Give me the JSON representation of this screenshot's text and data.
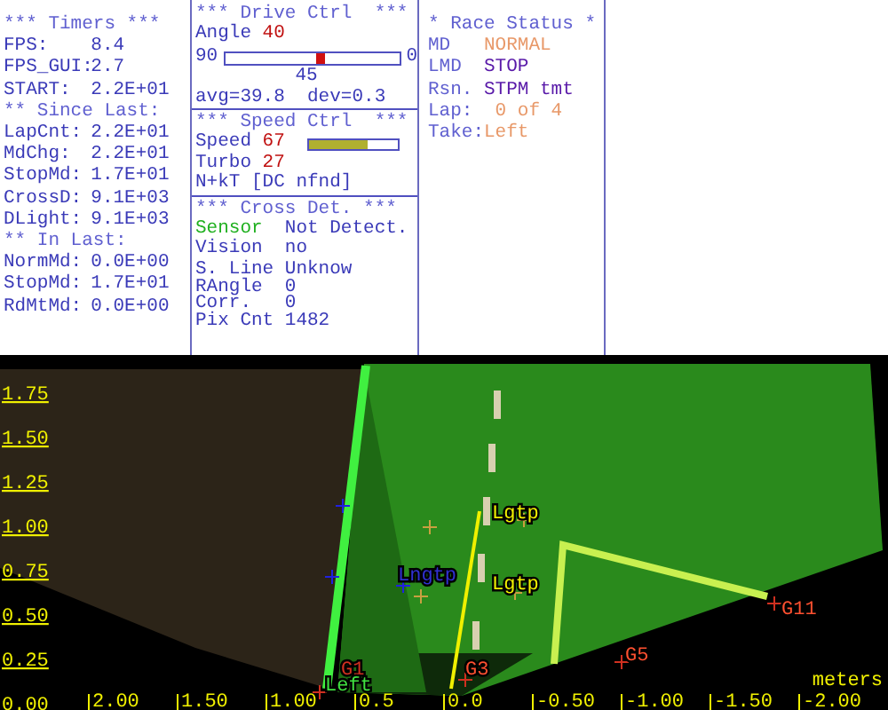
{
  "timers": [
    {
      "kind": "header",
      "text": "*** Timers ***"
    },
    {
      "kind": "stat",
      "label": "FPS:",
      "value": "8.4"
    },
    {
      "kind": "stat",
      "label": "FPS_GUI:",
      "value": "2.7"
    },
    {
      "kind": "stat",
      "label": "START:",
      "value": "2.2E+01"
    },
    {
      "kind": "header",
      "text": "** Since Last:"
    },
    {
      "kind": "stat",
      "label": "LapCnt:",
      "value": "2.2E+01"
    },
    {
      "kind": "stat",
      "label": "MdChg:",
      "value": "2.2E+01"
    },
    {
      "kind": "stat",
      "label": "StopMd:",
      "value": "1.7E+01"
    },
    {
      "kind": "stat",
      "label": "CrossD:",
      "value": "9.1E+03"
    },
    {
      "kind": "stat",
      "label": "DLight:",
      "value": "9.1E+03"
    },
    {
      "kind": "header",
      "text": "** In Last:"
    },
    {
      "kind": "stat",
      "label": "NormMd:",
      "value": "0.0E+00"
    },
    {
      "kind": "stat",
      "label": "StopMd:",
      "value": "1.7E+01"
    },
    {
      "kind": "stat",
      "label": "RdMtMd:",
      "value": "0.0E+00"
    }
  ],
  "drive": {
    "title": "*** Drive Ctrl  ***",
    "angle_label": "Angle",
    "angle": "40",
    "scale_min": "90",
    "scale_max": "0",
    "level": 0.556,
    "scale_mid": "45",
    "stats": "avg=39.8  dev=0.3"
  },
  "speed": {
    "title": "*** Speed Ctrl  ***",
    "speed_label": "Speed",
    "speed": "67",
    "level": 0.67,
    "turbo_label": "Turbo",
    "turbo": "27",
    "status": "N+kT [DC nfnd]"
  },
  "cross": {
    "title": "*** Cross Det. ***",
    "rows": [
      {
        "kind": "sensor",
        "label": "Sensor",
        "value": "Not Detect."
      },
      {
        "kind": "field",
        "label": "Vision",
        "value": "no"
      },
      {
        "kind": "field",
        "label": "S. Line",
        "value": "Unknow"
      },
      {
        "kind": "tight",
        "label": "RAngle",
        "value": "0"
      },
      {
        "kind": "tight",
        "label": "Corr.",
        "value": "0"
      },
      {
        "kind": "field",
        "label": "Pix Cnt",
        "value": "1482"
      }
    ]
  },
  "race": {
    "title": "* Race Status *",
    "rows": [
      {
        "label": "MD",
        "value": "NORMAL",
        "color": "#e89868"
      },
      {
        "label": "LMD",
        "value": "STOP",
        "color": "#5818a8"
      },
      {
        "label": "Rsn.",
        "value": "STPM tmt",
        "color": "#5818a8"
      },
      {
        "label": "Lap:",
        "value": " 0 of 4",
        "color": "#e89868"
      },
      {
        "label": "Take:",
        "value": "Left",
        "color": "#e89868"
      }
    ]
  },
  "camera": {
    "y_ticks": [
      "1.75",
      "1.50",
      "1.25",
      "1.00",
      "0.75",
      "0.50",
      "0.25",
      "0.00"
    ],
    "x_ticks": [
      "2.00",
      "1.50",
      "1.00",
      "0.5",
      "0.0",
      "-0.50",
      "-1.00",
      "-1.50",
      "-2.00"
    ],
    "unit": "meters",
    "markers": [
      {
        "label": "Lgtp",
        "color": "#f0f000"
      },
      {
        "label": "Lgtp",
        "color": "#f0f000"
      },
      {
        "label": "Lngtp",
        "color": "#3030d0"
      },
      {
        "label": "G1",
        "color": "#d03020"
      },
      {
        "label": "Left",
        "color": "#40e040"
      },
      {
        "label": "G3",
        "color": "#ff5030"
      },
      {
        "label": "G5",
        "color": "#ff5030"
      },
      {
        "label": "G11",
        "color": "#ff5030"
      }
    ]
  }
}
